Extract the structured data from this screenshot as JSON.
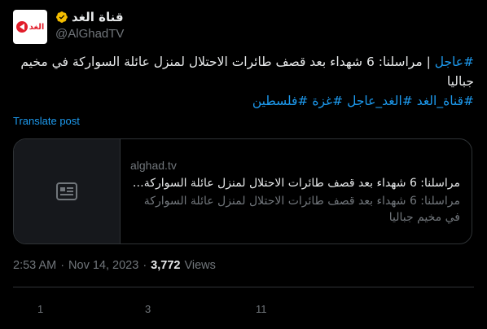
{
  "account": {
    "display_name": "قناة الغد",
    "handle": "@AlGhadTV",
    "avatar_text": "الغد",
    "verified_icon": "verified-badge-icon"
  },
  "tweet": {
    "hashtag_lead": "#عاجل",
    "text_main": " | مراسلنا: 6 شهداء بعد قصف طائرات الاحتلال لمنزل عائلة السواركة في مخيم جباليا",
    "hashtags": [
      "#قناة_الغد",
      "#الغد_عاجل",
      "#غزة",
      "#فلسطين"
    ],
    "translate_label": "Translate post"
  },
  "card": {
    "thumbnail_icon": "article-icon",
    "domain": "alghad.tv",
    "title": "مراسلنا: 6 شهداء بعد قصف طائرات الاحتلال لمنزل عائلة السواركة ف...",
    "description": "مراسلنا: 6 شهداء بعد قصف طائرات الاحتلال لمنزل عائلة السواركة في مخيم جباليا"
  },
  "meta": {
    "time": "2:53 AM",
    "separator": "·",
    "date": "Nov 14, 2023",
    "views_count": "3,772",
    "views_label": "Views"
  },
  "actions": {
    "replies": "1",
    "reposts": "3",
    "likes": "11"
  },
  "colors": {
    "background": "#000000",
    "text": "#e7e9ea",
    "muted": "#71767b",
    "link": "#1d9bf0",
    "border": "#2f3336",
    "verified": "#f4bd00"
  }
}
